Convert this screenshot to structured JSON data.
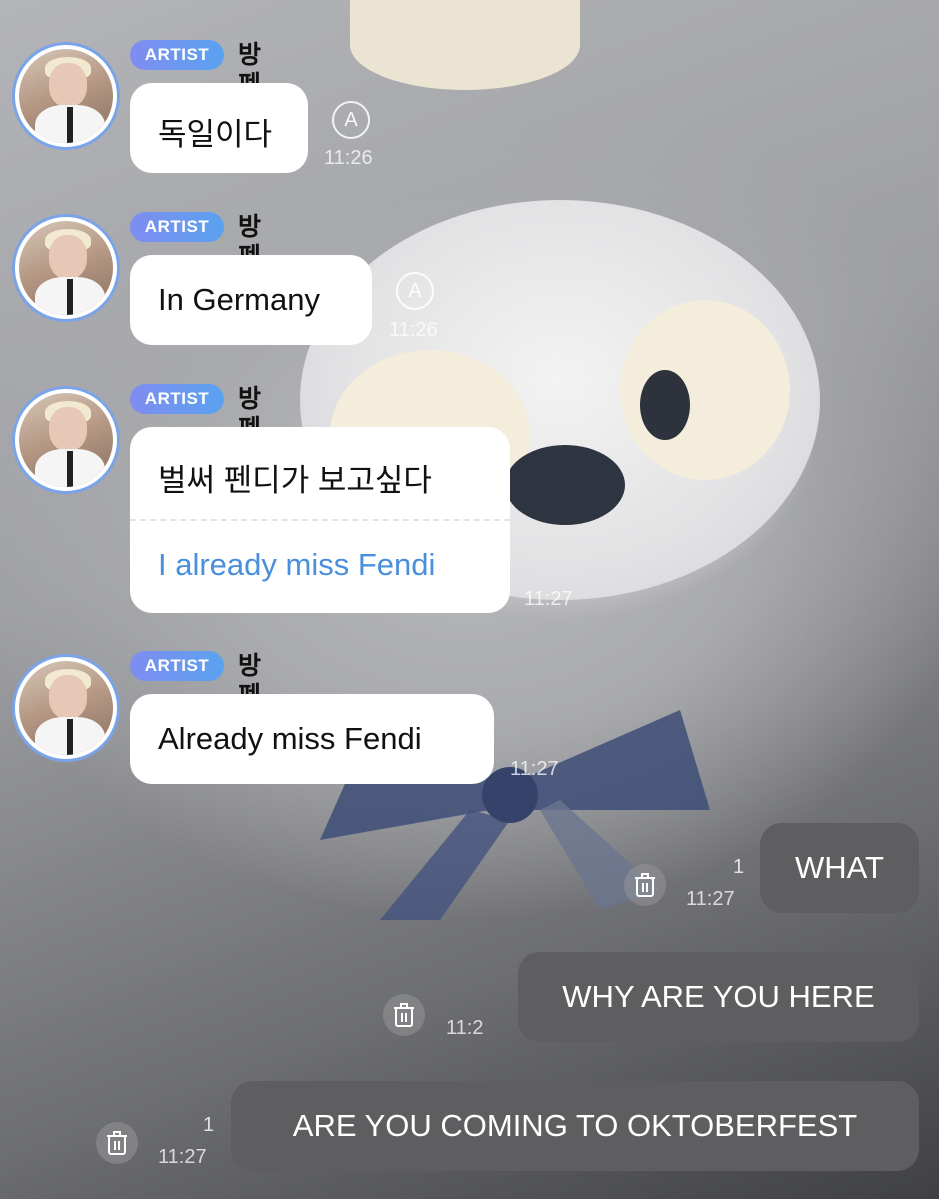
{
  "artist": {
    "badge": "ARTIST",
    "name": "방펜디"
  },
  "incoming": [
    {
      "text": "독일이다",
      "time": "11:26",
      "translate_icon": "translate-icon"
    },
    {
      "text": "In Germany",
      "time": "11:26",
      "translate_icon": "translate-icon"
    },
    {
      "text": "벌써 펜디가 보고싶다",
      "translation": "I already miss Fendi",
      "time": "11:27"
    },
    {
      "text": "Already miss Fendi",
      "time": "11:27"
    }
  ],
  "outgoing": [
    {
      "text": "WHAT",
      "unread": "1",
      "time": "11:27",
      "icon": "trash-icon"
    },
    {
      "text": "WHY ARE YOU HERE",
      "time": "11:2",
      "icon": "trash-icon"
    },
    {
      "text": "ARE YOU COMING TO OKTOBERFEST",
      "unread": "1",
      "time": "11:27",
      "icon": "trash-icon"
    }
  ],
  "colors": {
    "badge_start": "#7f8df0",
    "badge_end": "#5aa2f0",
    "translation_text": "#4a8fdc",
    "outgoing_bubble": "#5e5e60"
  }
}
